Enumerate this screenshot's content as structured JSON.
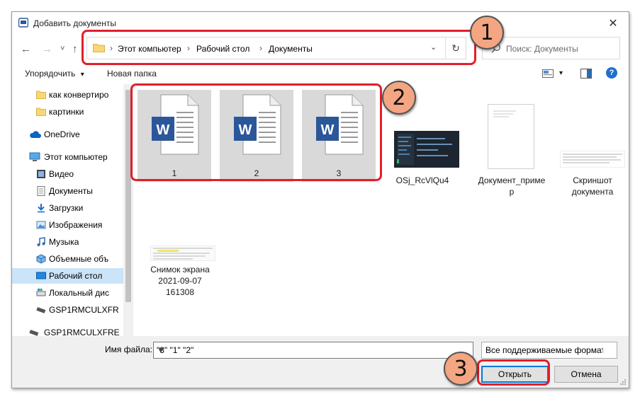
{
  "window": {
    "title": "Добавить документы",
    "close_glyph": "✕"
  },
  "nav": {
    "back": "←",
    "forward": "→",
    "recent": "˅",
    "up": "↑"
  },
  "address": {
    "crumbs": [
      "Этот компьютер",
      "Рабочий стол",
      "Документы"
    ],
    "separator": "›",
    "dropdown": "⌄",
    "refresh": "↻"
  },
  "search": {
    "placeholder": "Поиск: Документы"
  },
  "toolbar": {
    "organize_label": "Упорядочить",
    "organize_arrow": "▾",
    "new_folder_label": "Новая папка",
    "view_arrow": "▾",
    "help_glyph": "?"
  },
  "sidebar": {
    "items": [
      {
        "label": "как конвертиро",
        "icon": "folder-icon"
      },
      {
        "label": "картинки",
        "icon": "folder-icon"
      },
      {
        "label": "OneDrive",
        "icon": "cloud-icon"
      },
      {
        "label": "Этот компьютер",
        "icon": "computer-icon"
      },
      {
        "label": "Видео",
        "icon": "video-icon"
      },
      {
        "label": "Документы",
        "icon": "documents-icon"
      },
      {
        "label": "Загрузки",
        "icon": "downloads-icon"
      },
      {
        "label": "Изображения",
        "icon": "pictures-icon"
      },
      {
        "label": "Музыка",
        "icon": "music-icon"
      },
      {
        "label": "Объемные объ",
        "icon": "3d-objects-icon"
      },
      {
        "label": "Рабочий стол",
        "icon": "desktop-icon",
        "selected": true
      },
      {
        "label": "Локальный дис",
        "icon": "drive-icon"
      },
      {
        "label": "GSP1RMCULXFR",
        "icon": "usb-drive-icon"
      },
      {
        "label": "GSP1RMCULXFRE",
        "icon": "usb-drive-icon"
      }
    ]
  },
  "files": [
    {
      "name": "1",
      "type": "word",
      "selected": true
    },
    {
      "name": "2",
      "type": "word",
      "selected": true
    },
    {
      "name": "3",
      "type": "word",
      "selected": true
    },
    {
      "name": "OSj_RcVlQu4",
      "type": "image"
    },
    {
      "name_line1": "Документ_приме",
      "name_line2": "р",
      "type": "document-thumb"
    },
    {
      "name_line1": "Скриншот",
      "name_line2": "документа",
      "type": "document-thumb"
    },
    {
      "name_line1": "Снимок экрана",
      "name_line2": "2021-09-07",
      "name_line3": "161308",
      "type": "screenshot-thumb"
    }
  ],
  "word_letter": "W",
  "bottom": {
    "filename_label": "Имя файла:",
    "filename_value": "\"3\" \"1\" \"2\"",
    "filter_value": "Все поддерживаемые формат",
    "open_button": "Открыть",
    "cancel_button": "Отмена"
  },
  "annotations": {
    "badge1": "1",
    "badge2": "2",
    "badge3": "3",
    "highlight_color": "#e0202a",
    "badge_color": "#f4a582"
  },
  "colors": {
    "selection": "#cce4f7",
    "accent": "#0078d7",
    "word_blue": "#2b579a",
    "folder_yellow": "#f8d775"
  }
}
